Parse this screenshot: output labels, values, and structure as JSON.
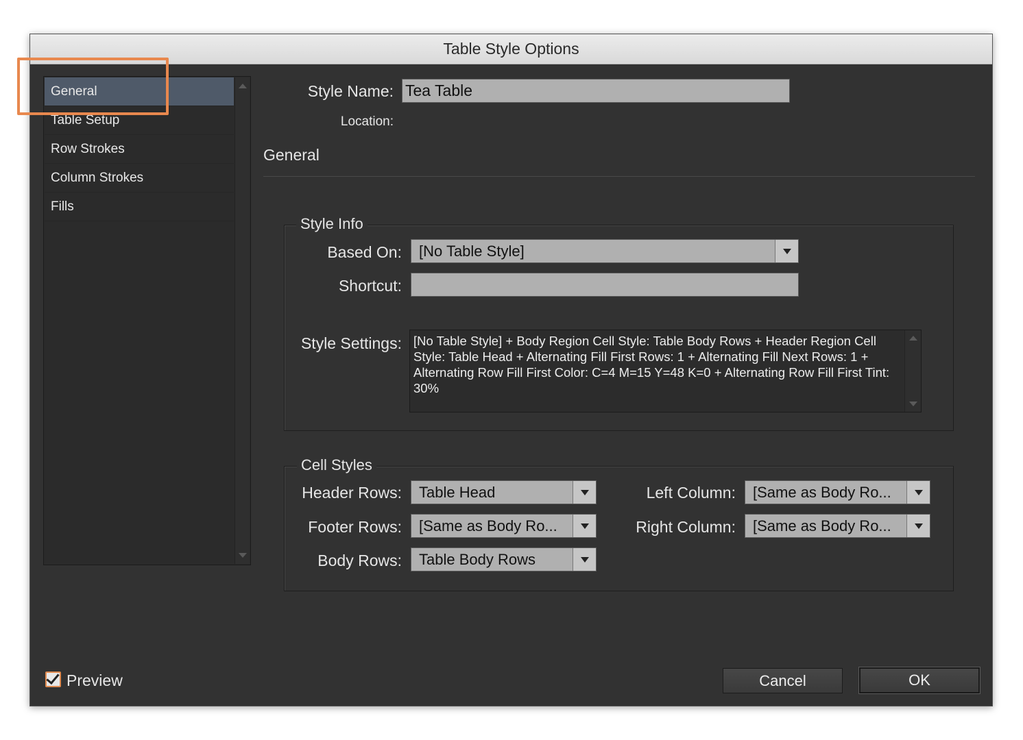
{
  "window": {
    "title": "Table Style Options"
  },
  "sidebar": {
    "items": [
      {
        "label": "General",
        "selected": true
      },
      {
        "label": "Table Setup",
        "selected": false
      },
      {
        "label": "Row Strokes",
        "selected": false
      },
      {
        "label": "Column Strokes",
        "selected": false
      },
      {
        "label": "Fills",
        "selected": false
      }
    ]
  },
  "style_name": {
    "label": "Style Name:",
    "value": "Tea Table"
  },
  "location": {
    "label": "Location:",
    "value": ""
  },
  "section": {
    "title": "General"
  },
  "style_info": {
    "title": "Style Info",
    "based_on": {
      "label": "Based On:",
      "value": "[No Table Style]"
    },
    "shortcut": {
      "label": "Shortcut:",
      "value": ""
    },
    "style_settings": {
      "label": "Style Settings:",
      "text": "[No Table Style] + Body Region Cell Style: Table Body Rows + Header Region Cell Style: Table Head + Alternating Fill First Rows: 1 + Alternating Fill Next Rows: 1 + Alternating Row Fill First Color: C=4 M=15 Y=48 K=0 + Alternating Row Fill First Tint: 30%"
    }
  },
  "cell_styles": {
    "title": "Cell Styles",
    "header_rows": {
      "label": "Header Rows:",
      "value": "Table Head"
    },
    "footer_rows": {
      "label": "Footer Rows:",
      "value": "[Same as Body Ro..."
    },
    "body_rows": {
      "label": "Body Rows:",
      "value": "Table Body Rows"
    },
    "left_column": {
      "label": "Left Column:",
      "value": "[Same as Body Ro..."
    },
    "right_column": {
      "label": "Right Column:",
      "value": "[Same as Body Ro..."
    }
  },
  "footer": {
    "preview": {
      "label": "Preview",
      "checked": true
    },
    "cancel_label": "Cancel",
    "ok_label": "OK"
  },
  "colors": {
    "dialog_bg": "#323232",
    "selected_item": "#4f5a69",
    "highlight": "#e8884e",
    "field_bg": "#b0b0b0"
  }
}
